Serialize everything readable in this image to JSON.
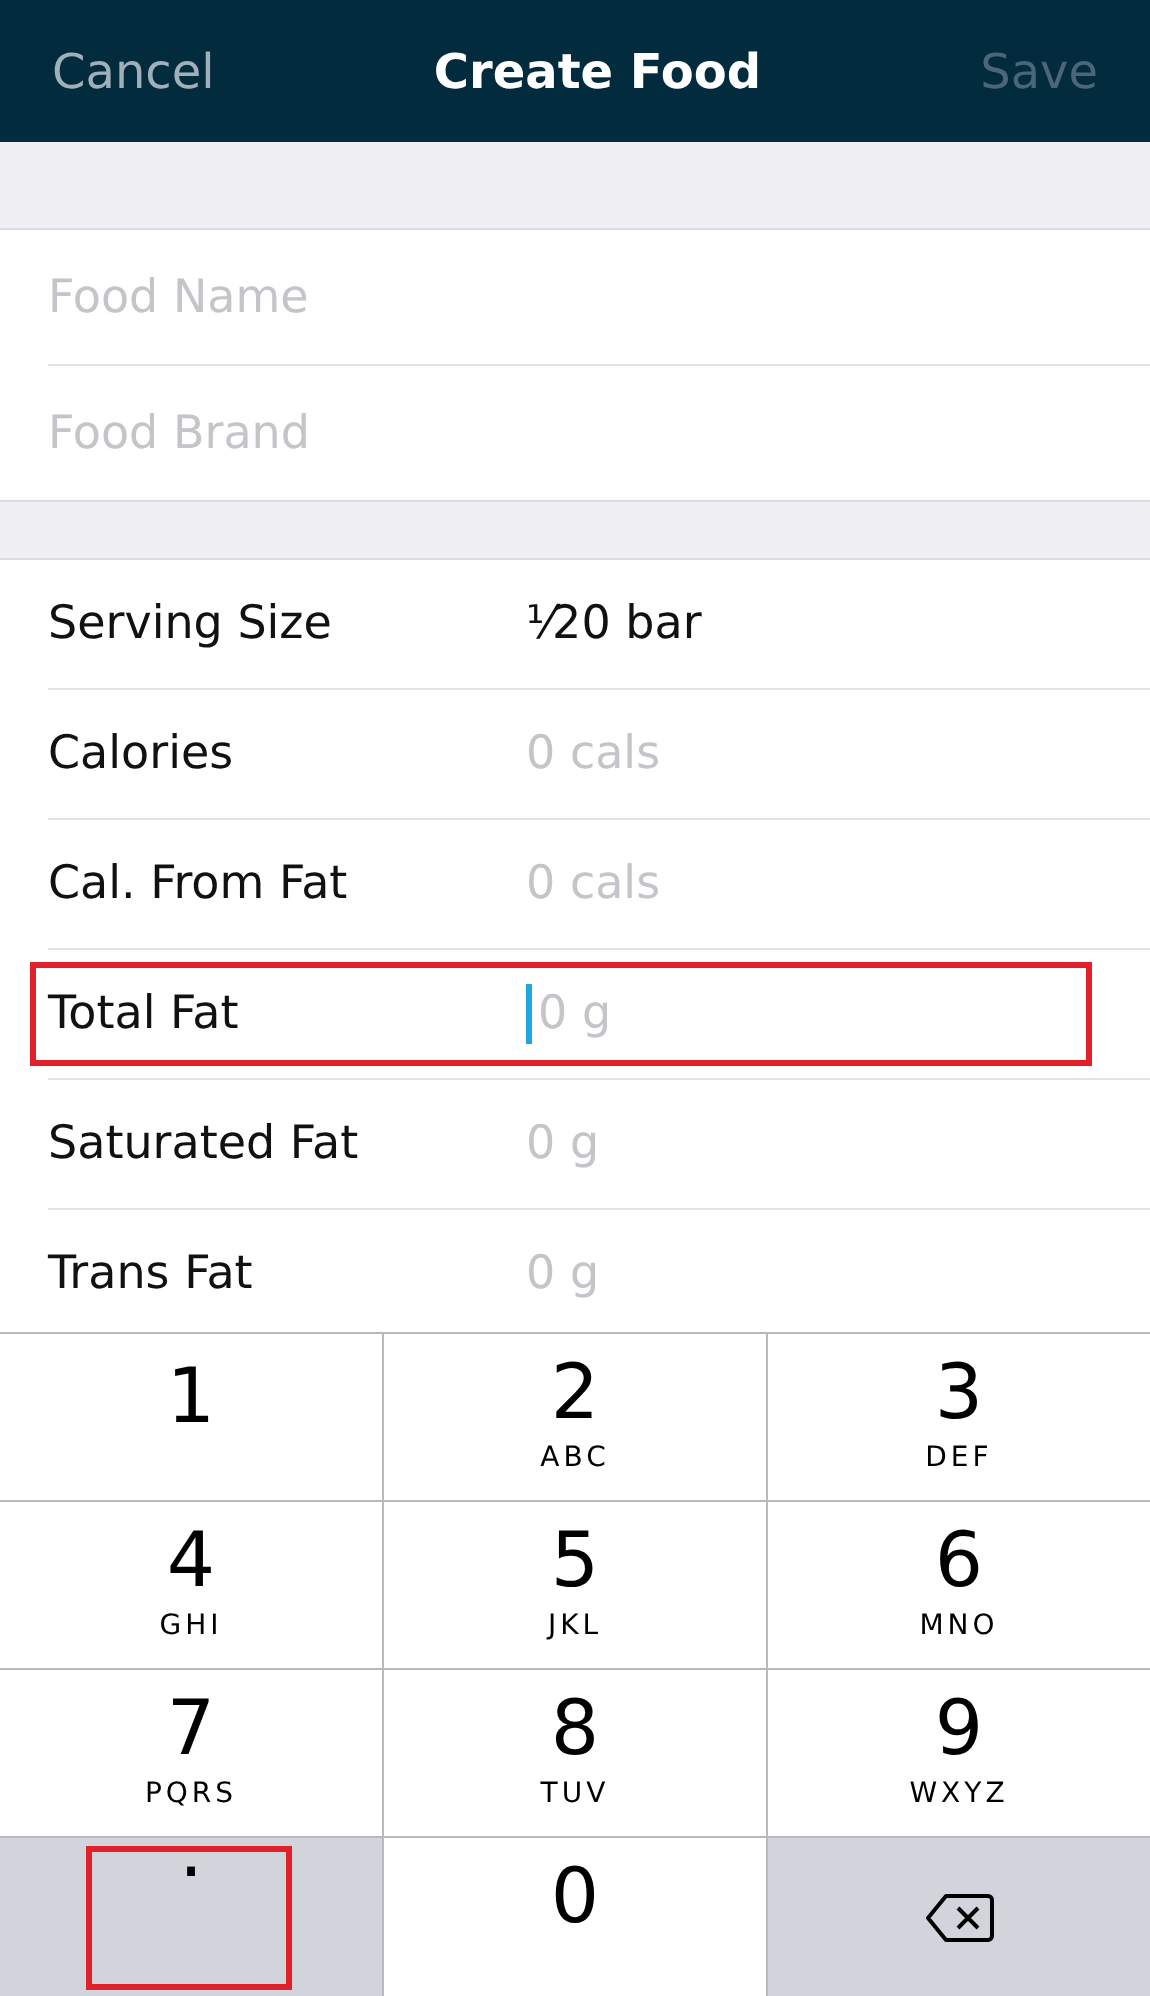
{
  "navbar": {
    "cancel": "Cancel",
    "title": "Create Food",
    "save": {
      "label": "Save",
      "disabled": true
    }
  },
  "name_fields": [
    {
      "placeholder": "Food Name"
    },
    {
      "placeholder": "Food Brand"
    }
  ],
  "nutrients": [
    {
      "label": "Serving Size",
      "value": "⅟20 bar",
      "focused": false,
      "highlighted": false
    },
    {
      "label": "Calories",
      "placeholder": "0 cals",
      "focused": false,
      "highlighted": false
    },
    {
      "label": "Cal. From Fat",
      "placeholder": "0 cals",
      "focused": false,
      "highlighted": false
    },
    {
      "label": "Total Fat",
      "placeholder": "0 g",
      "focused": true,
      "highlighted": true
    },
    {
      "label": "Saturated Fat",
      "placeholder": "0 g",
      "focused": false,
      "highlighted": false
    },
    {
      "label": "Trans Fat",
      "placeholder": "0 g",
      "focused": false,
      "highlighted": false
    }
  ],
  "keypad": [
    {
      "kind": "digit",
      "digit": "1",
      "highlighted": false
    },
    {
      "kind": "digit",
      "digit": "2",
      "letters": "ABC",
      "highlighted": false
    },
    {
      "kind": "digit",
      "digit": "3",
      "letters": "DEF",
      "highlighted": false
    },
    {
      "kind": "digit",
      "digit": "4",
      "letters": "GHI",
      "highlighted": false
    },
    {
      "kind": "digit",
      "digit": "5",
      "letters": "JKL",
      "highlighted": false
    },
    {
      "kind": "digit",
      "digit": "6",
      "letters": "MNO",
      "highlighted": false
    },
    {
      "kind": "digit",
      "digit": "7",
      "letters": "PQRS",
      "highlighted": false
    },
    {
      "kind": "digit",
      "digit": "8",
      "letters": "TUV",
      "highlighted": false
    },
    {
      "kind": "digit",
      "digit": "9",
      "letters": "WXYZ",
      "highlighted": false
    },
    {
      "kind": "decimal",
      "digit": ".",
      "highlighted": true
    },
    {
      "kind": "digit",
      "digit": "0",
      "highlighted": false
    },
    {
      "kind": "backspace",
      "highlighted": false
    }
  ]
}
